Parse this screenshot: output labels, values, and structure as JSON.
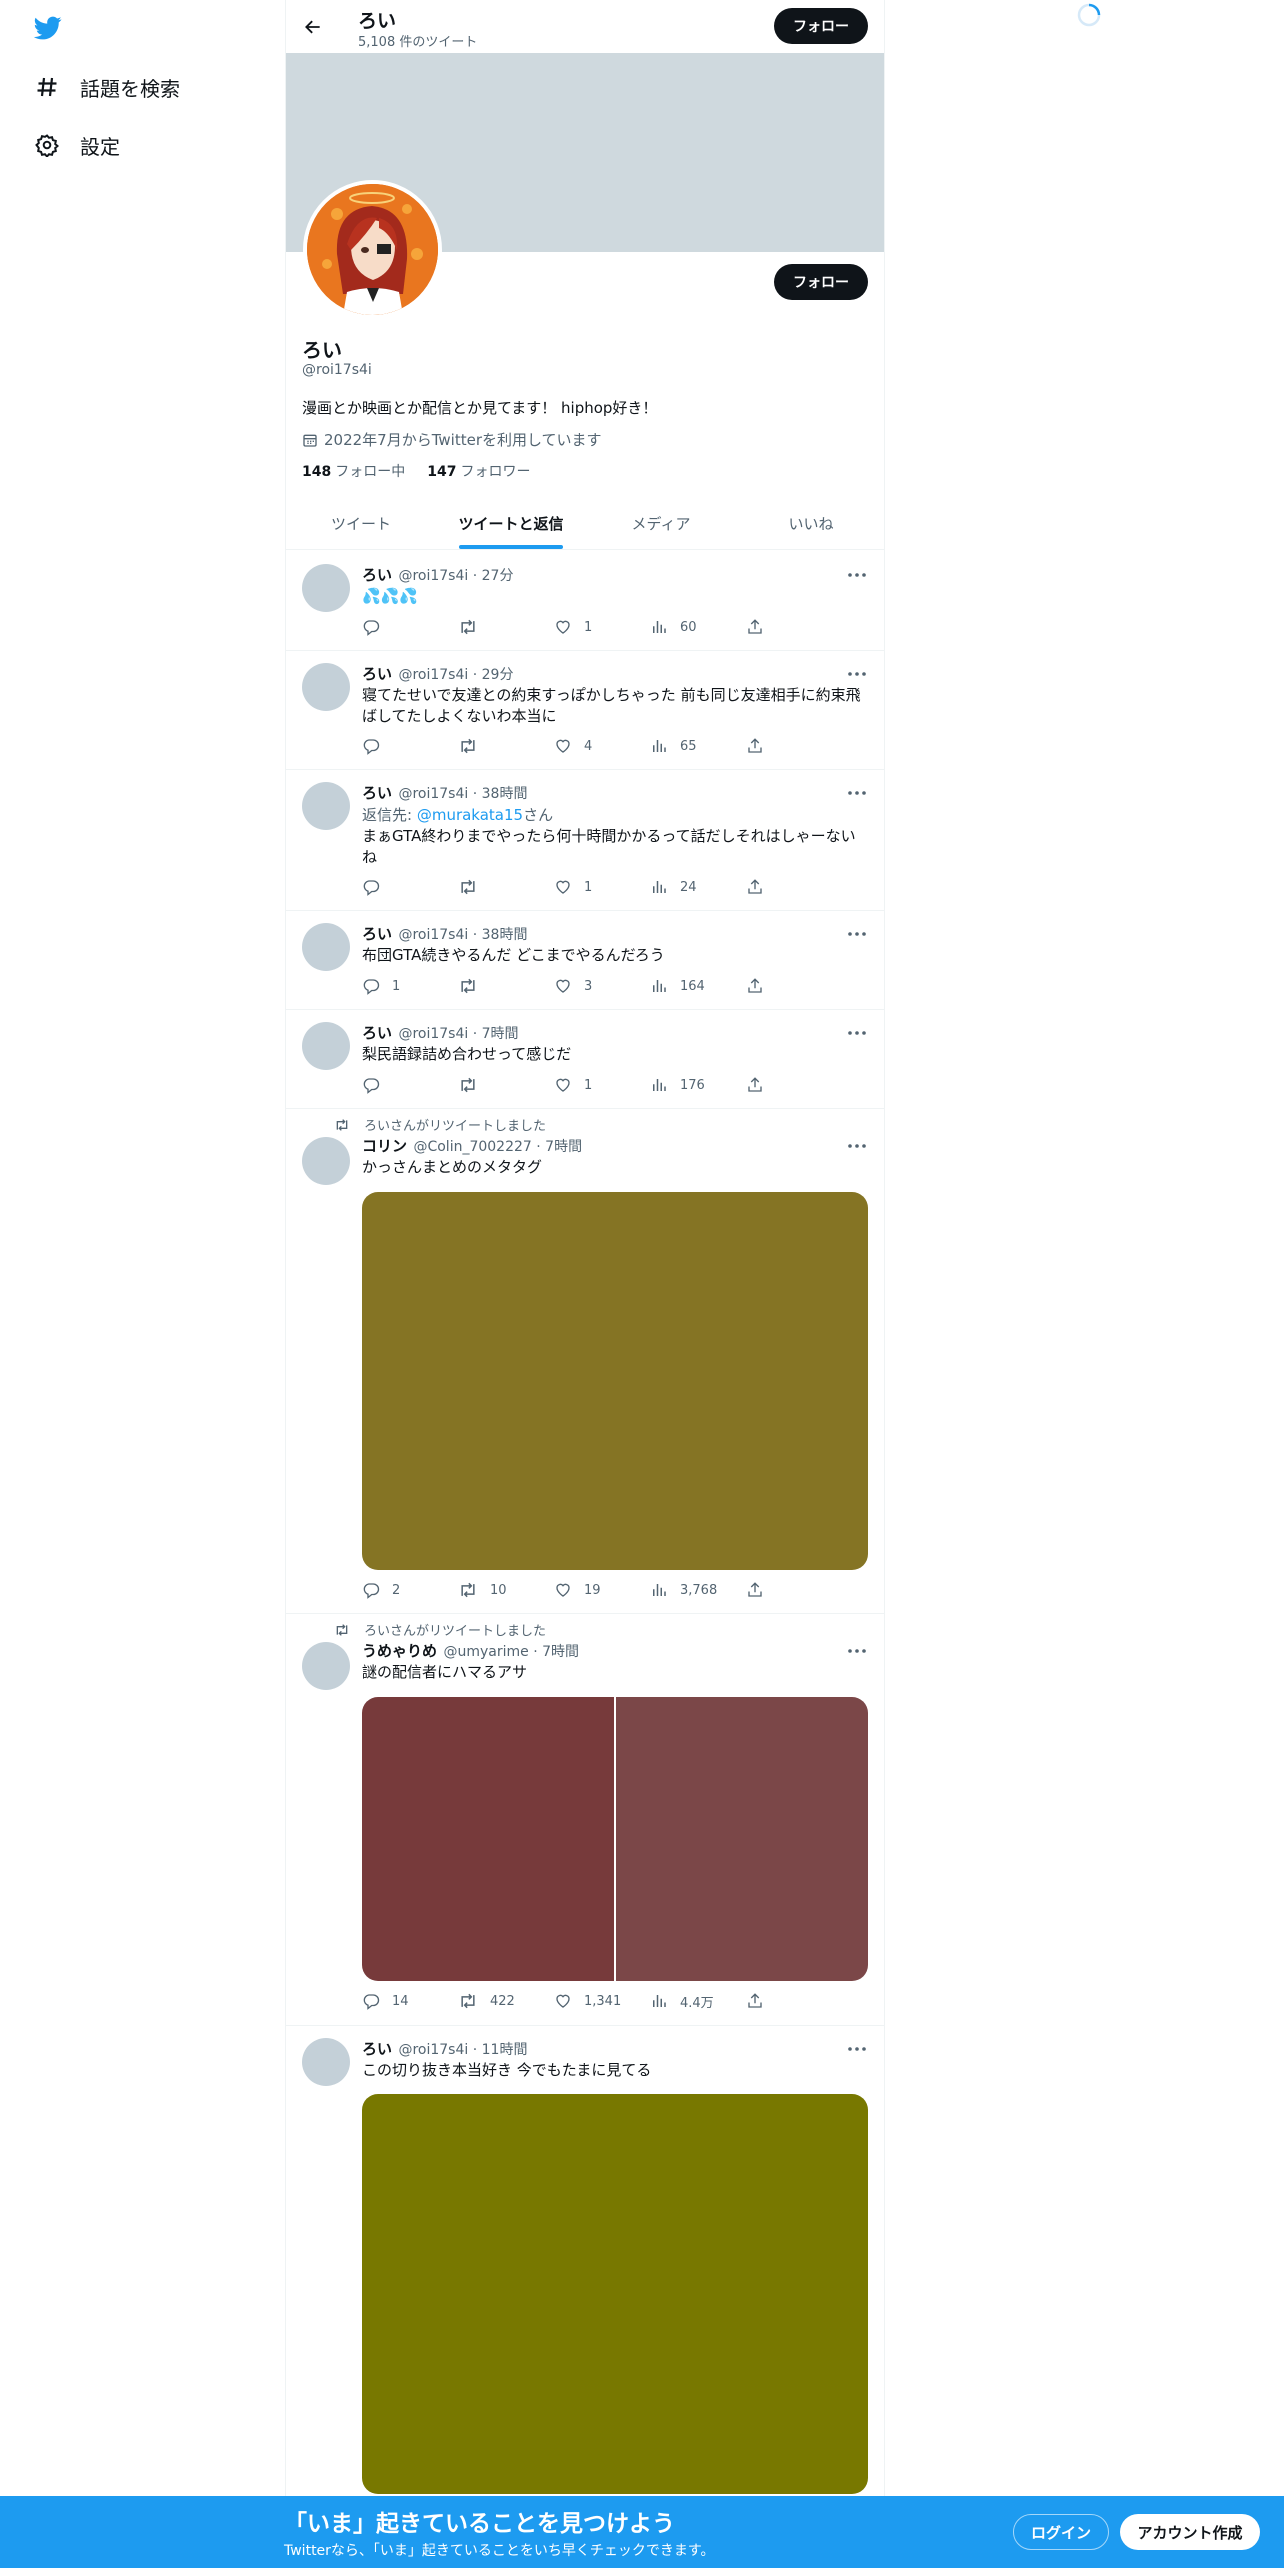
{
  "sidebar": {
    "logo_icon": "twitter-bird-icon",
    "items": [
      {
        "label": "話題を検索",
        "icon": "hashtag-icon"
      },
      {
        "label": "設定",
        "icon": "gear-icon"
      }
    ]
  },
  "header": {
    "name": "ろい",
    "tweet_count": "5,108 件のツイート",
    "follow_label": "フォロー"
  },
  "profile": {
    "name": "ろい",
    "handle": "@roi17s4i",
    "bio": "漫画とか映画とか配信とか見てます！ hiphop好き！",
    "joined": "2022年7月からTwitterを利用しています",
    "following_count": "148",
    "following_label": "フォロー中",
    "followers_count": "147",
    "followers_label": "フォロワー",
    "follow_label": "フォロー"
  },
  "tabs": [
    {
      "label": "ツイート"
    },
    {
      "label": "ツイートと返信",
      "active": true
    },
    {
      "label": "メディア"
    },
    {
      "label": "いいね"
    }
  ],
  "tweets": [
    {
      "name": "ろい",
      "handle": "@roi17s4i",
      "time": "27分",
      "text": "💦💦💦",
      "replies": "",
      "retweets": "",
      "likes": "1",
      "views": "60"
    },
    {
      "name": "ろい",
      "handle": "@roi17s4i",
      "time": "29分",
      "text": "寝てたせいで友達との約束すっぽかしちゃった 前も同じ友達相手に約束飛ばしてたしよくないわ本当に",
      "replies": "",
      "retweets": "",
      "likes": "4",
      "views": "65"
    },
    {
      "name": "ろい",
      "handle": "@roi17s4i",
      "time": "38時間",
      "reply_prefix": "返信先: ",
      "reply_to": "@murakata15",
      "reply_suffix": "さん",
      "text": "まぁGTA終わりまでやったら何十時間かかるって話だしそれはしゃーないね",
      "replies": "",
      "retweets": "",
      "likes": "1",
      "views": "24"
    },
    {
      "name": "ろい",
      "handle": "@roi17s4i",
      "time": "38時間",
      "text": "布団GTA続きやるんだ どこまでやるんだろう",
      "replies": "1",
      "retweets": "",
      "likes": "3",
      "views": "164"
    },
    {
      "name": "ろい",
      "handle": "@roi17s4i",
      "time": "7時間",
      "text": "梨民語録詰め合わせって感じだ",
      "replies": "",
      "retweets": "",
      "likes": "1",
      "views": "176"
    },
    {
      "retweet_note": "ろいさんがリツイートしました",
      "name": "コリン",
      "handle": "@Colin_7002227",
      "time": "7時間",
      "text": "かっさんまとめのメタタグ",
      "replies": "2",
      "retweets": "10",
      "likes": "19",
      "views": "3,768",
      "media_color": "#857424"
    },
    {
      "retweet_note": "ろいさんがリツイートしました",
      "name": "うめゃりめ",
      "handle": "@umyarime",
      "time": "7時間",
      "text": "謎の配信者にハマるアサ",
      "replies": "14",
      "retweets": "422",
      "likes": "1,341",
      "views": "4.4万",
      "media_colors": [
        "#773a3b",
        "#7b4748"
      ]
    },
    {
      "name": "ろい",
      "handle": "@roi17s4i",
      "time": "11時間",
      "text": "この切り抜き本当好き 今でもたまに見てる",
      "media_color": "#787800"
    }
  ],
  "bottom_banner": {
    "title": "「いま」起きていることを見つけよう",
    "subtitle": "Twitterなら、「いま」起きていることをいち早くチェックできます。",
    "login_label": "ログイン",
    "signup_label": "アカウント作成"
  },
  "colors": {
    "accent": "#1d9bf0",
    "banner": "#cfd9de",
    "avatar_placeholder": "#c4d0d8",
    "profile_avatar_bg": "#e9761f"
  }
}
